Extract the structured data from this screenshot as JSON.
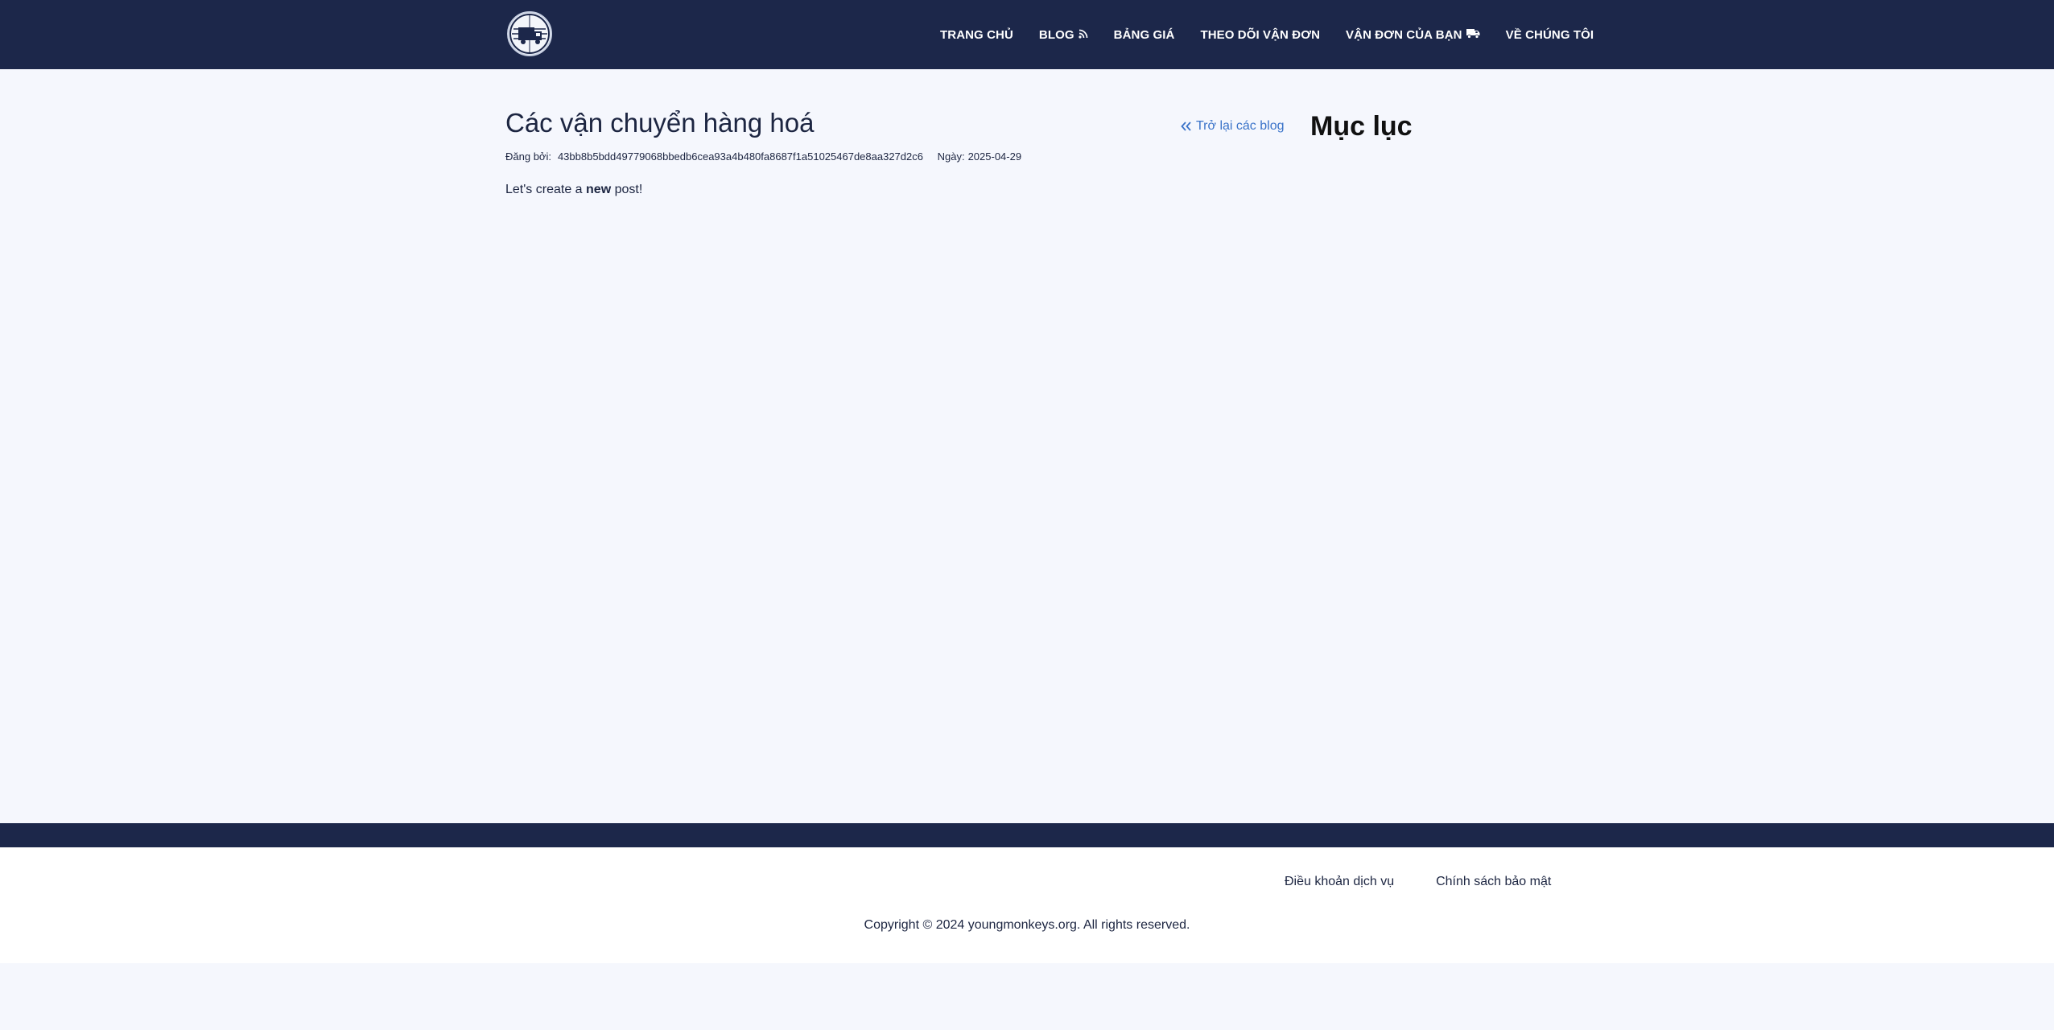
{
  "nav": {
    "logo_icon": "truck-globe-logo",
    "items": [
      {
        "label": "TRANG CHỦ"
      },
      {
        "label": "BLOG",
        "icon": "rss-icon"
      },
      {
        "label": "BẢNG GIÁ"
      },
      {
        "label": "THEO DÕI VẬN ĐƠN"
      },
      {
        "label": "VẬN ĐƠN CỦA BẠN",
        "icon": "truck-icon"
      },
      {
        "label": "VỀ CHÚNG TÔI"
      }
    ]
  },
  "post": {
    "title": "Các vận chuyển hàng hoá",
    "author_label": "Đăng bởi:",
    "author": "43bb8b5bdd49779068bbedb6cea93a4b480fa8687f1a51025467de8aa327d2c6",
    "date_label": "Ngày:",
    "date": "2025-04-29",
    "body_before": "Let's create a",
    "body_bold": "new",
    "body_after": "post!"
  },
  "sidebar": {
    "back_label": "Trở lại các blog",
    "back_icon": "double-chevron-left-icon",
    "toc_title": "Mục lục"
  },
  "footer": {
    "links": [
      {
        "label": "Điều khoản dịch vụ"
      },
      {
        "label": "Chính sách bảo mật"
      }
    ],
    "copyright": "Copyright © 2024 youngmonkeys.org. All rights reserved."
  },
  "colors": {
    "nav_bg": "#1c274a",
    "page_bg": "#f5f7fd",
    "link": "#3a73c9",
    "text": "#1c2541"
  }
}
